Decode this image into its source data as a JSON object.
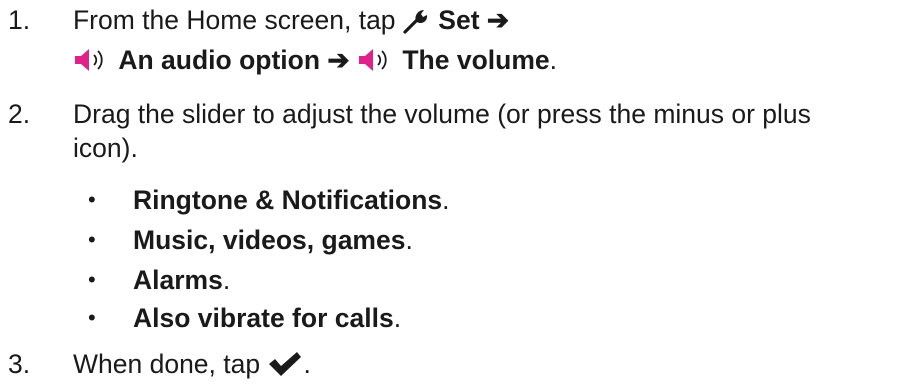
{
  "steps": [
    {
      "number": "1.",
      "line1_prefix": "From the Home screen, tap",
      "line1_bold": "Set",
      "arrow": "➔",
      "line2_item1": "An audio option",
      "line2_item2": "The volume",
      "line2_end": "."
    },
    {
      "number": "2.",
      "line1": "Drag the slider to adjust the volume (or press the minus or plus",
      "line2": "icon).",
      "bullets": [
        {
          "text": "Ringtone & Notifications",
          "end": "."
        },
        {
          "text": "Music, videos, games",
          "end": "."
        },
        {
          "text": "Alarms",
          "end": "."
        },
        {
          "text": "Also vibrate for calls",
          "end": "."
        }
      ]
    },
    {
      "number": "3.",
      "text": "When done, tap",
      "end": "."
    }
  ],
  "icons": {
    "settings": "wrench-icon",
    "audio": "speaker-icon",
    "done": "checkmark-icon"
  },
  "colors": {
    "speaker": "#e0218a",
    "text": "#1a1a1a"
  }
}
